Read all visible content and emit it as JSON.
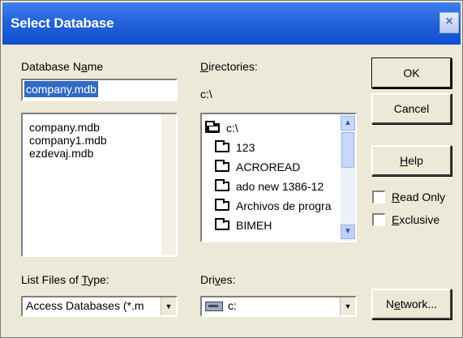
{
  "window": {
    "title": "Select Database",
    "close_icon": "×"
  },
  "database_name": {
    "label_pre": "Database N",
    "label_mnemonic": "a",
    "label_post": "me",
    "value": "company.mdb"
  },
  "files": [
    "company.mdb",
    "company1.mdb",
    "ezdevaj.mdb"
  ],
  "directories": {
    "label_mnemonic": "D",
    "label_post": "irectories:",
    "current_path": "c:\\",
    "tree": [
      "c:\\",
      "123",
      "ACROREAD",
      "ado new 1386-12",
      "Archivos de progra",
      "BIMEH"
    ]
  },
  "buttons": {
    "ok": "OK",
    "cancel": "Cancel",
    "help_mnemonic": "H",
    "help_post": "elp",
    "network_pre": "N",
    "network_mnemonic": "e",
    "network_post": "twork..."
  },
  "options": {
    "read_only_mnemonic": "R",
    "read_only_post": "ead Only",
    "exclusive_mnemonic": "E",
    "exclusive_post": "xclusive"
  },
  "file_type": {
    "label_pre": "List Files of ",
    "label_mnemonic": "T",
    "label_post": "ype:",
    "value": "Access Databases (*.m"
  },
  "drives": {
    "label_pre": "Dri",
    "label_mnemonic": "v",
    "label_post": "es:",
    "value": "c:"
  }
}
